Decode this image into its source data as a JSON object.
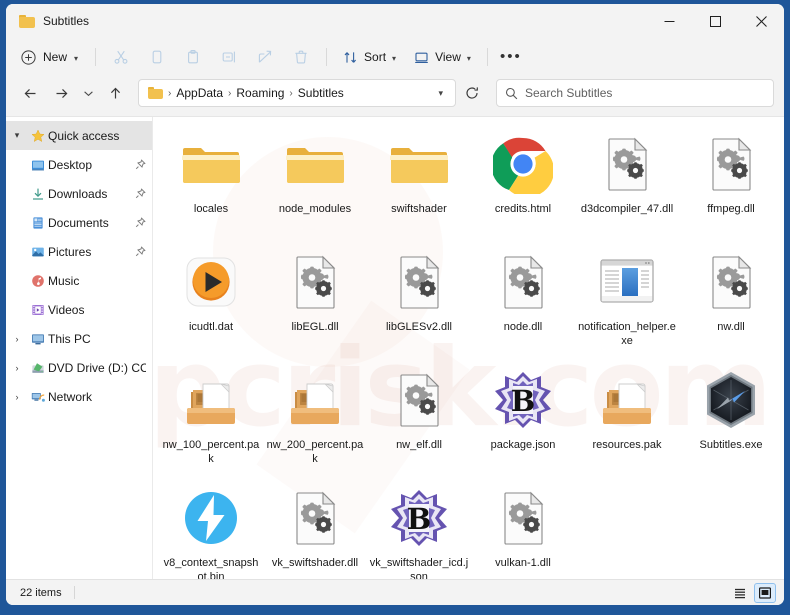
{
  "window": {
    "title": "Subtitles",
    "controls": {
      "minimize": "minimize-button",
      "maximize": "maximize-button",
      "close": "close-button"
    }
  },
  "toolbar": {
    "new_label": "New",
    "sort_label": "Sort",
    "view_label": "View",
    "more_label": "•••",
    "icons": [
      "cut-icon",
      "copy-icon",
      "paste-icon",
      "rename-icon",
      "share-icon",
      "delete-icon"
    ]
  },
  "address": {
    "back": "back-button",
    "forward": "forward-button",
    "recent": "recent-locations-button",
    "up": "up-button",
    "breadcrumb": [
      "AppData",
      "Roaming",
      "Subtitles"
    ],
    "separator": "›",
    "refresh": "refresh-button"
  },
  "search": {
    "placeholder": "Search Subtitles"
  },
  "sidebar": {
    "items": [
      {
        "label": "Quick access",
        "icon": "star-icon",
        "twisty": "⌄",
        "level": 0,
        "selected": true,
        "pinned": false
      },
      {
        "label": "Desktop",
        "icon": "desktop-icon",
        "twisty": "",
        "level": 1,
        "selected": false,
        "pinned": true
      },
      {
        "label": "Downloads",
        "icon": "downloads-icon",
        "twisty": "",
        "level": 1,
        "selected": false,
        "pinned": true
      },
      {
        "label": "Documents",
        "icon": "documents-icon",
        "twisty": "",
        "level": 1,
        "selected": false,
        "pinned": true
      },
      {
        "label": "Pictures",
        "icon": "pictures-icon",
        "twisty": "",
        "level": 1,
        "selected": false,
        "pinned": true
      },
      {
        "label": "Music",
        "icon": "music-icon",
        "twisty": "",
        "level": 1,
        "selected": false,
        "pinned": false
      },
      {
        "label": "Videos",
        "icon": "videos-icon",
        "twisty": "",
        "level": 1,
        "selected": false,
        "pinned": false
      },
      {
        "label": "This PC",
        "icon": "this-pc-icon",
        "twisty": "›",
        "level": 0,
        "selected": false,
        "pinned": false
      },
      {
        "label": "DVD Drive (D:) CCCC",
        "icon": "dvd-drive-icon",
        "twisty": "›",
        "level": 0,
        "selected": false,
        "pinned": false
      },
      {
        "label": "Network",
        "icon": "network-icon",
        "twisty": "›",
        "level": 0,
        "selected": false,
        "pinned": false
      }
    ]
  },
  "files": [
    {
      "name": "locales",
      "icon": "folder-icon"
    },
    {
      "name": "node_modules",
      "icon": "folder-icon"
    },
    {
      "name": "swiftshader",
      "icon": "folder-icon"
    },
    {
      "name": "credits.html",
      "icon": "chrome-icon"
    },
    {
      "name": "d3dcompiler_47.dll",
      "icon": "dll-icon"
    },
    {
      "name": "ffmpeg.dll",
      "icon": "dll-icon"
    },
    {
      "name": "icudtl.dat",
      "icon": "media-play-icon"
    },
    {
      "name": "libEGL.dll",
      "icon": "dll-icon"
    },
    {
      "name": "libGLESv2.dll",
      "icon": "dll-icon"
    },
    {
      "name": "node.dll",
      "icon": "dll-icon"
    },
    {
      "name": "notification_helper.exe",
      "icon": "app-window-icon"
    },
    {
      "name": "nw.dll",
      "icon": "dll-icon"
    },
    {
      "name": "nw_100_percent.pak",
      "icon": "pak-box-icon"
    },
    {
      "name": "nw_200_percent.pak",
      "icon": "pak-box-icon"
    },
    {
      "name": "nw_elf.dll",
      "icon": "dll-icon"
    },
    {
      "name": "package.json",
      "icon": "bbedit-json-icon"
    },
    {
      "name": "resources.pak",
      "icon": "pak-box-icon"
    },
    {
      "name": "Subtitles.exe",
      "icon": "compass-hex-icon"
    },
    {
      "name": "v8_context_snapshot.bin",
      "icon": "bolt-circle-icon"
    },
    {
      "name": "vk_swiftshader.dll",
      "icon": "dll-icon"
    },
    {
      "name": "vk_swiftshader_icd.json",
      "icon": "bbedit-json-icon"
    },
    {
      "name": "vulkan-1.dll",
      "icon": "dll-icon"
    }
  ],
  "statusbar": {
    "item_count": "22 items",
    "views": [
      {
        "name": "details-view-toggle",
        "active": false
      },
      {
        "name": "large-icons-view-toggle",
        "active": true
      }
    ]
  },
  "watermark": {
    "text": "pcrisk.com"
  },
  "colors": {
    "frame": "#1f5699",
    "chrome": "#f3f3f3",
    "accent": "#0067c0",
    "folder": "#f2c14e",
    "selection": "#e4e4e4"
  }
}
